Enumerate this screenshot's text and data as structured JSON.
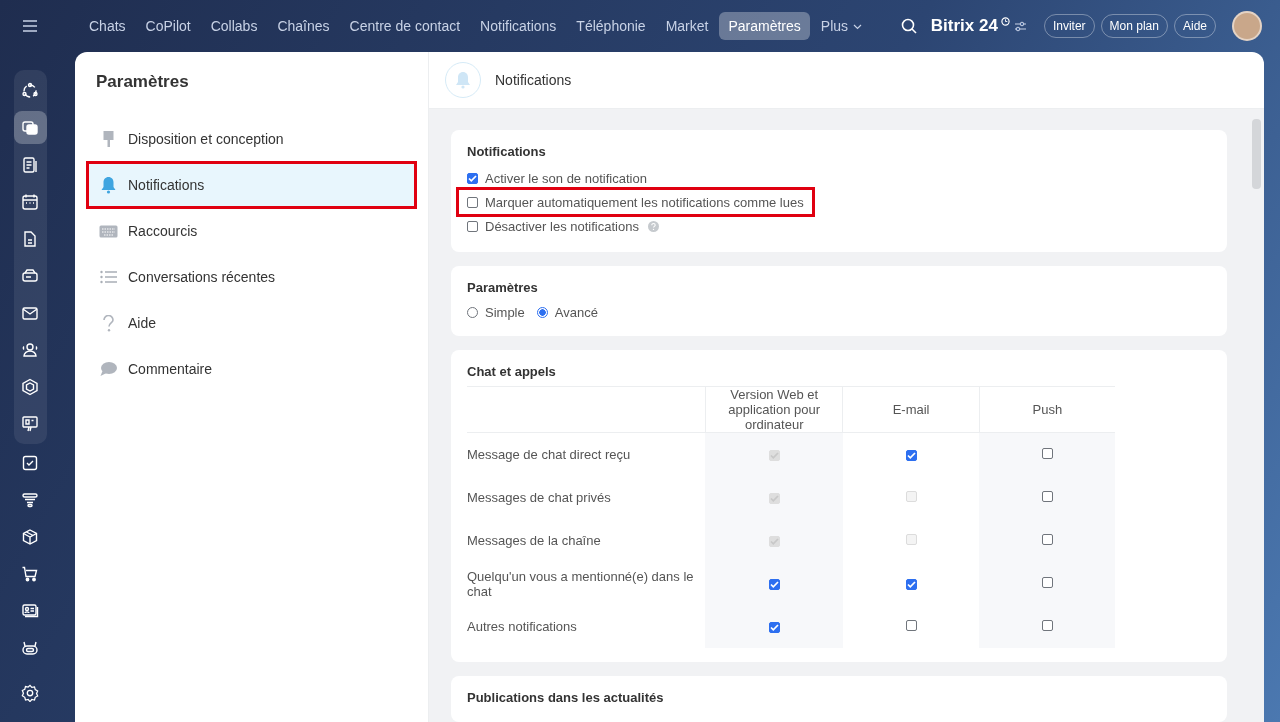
{
  "top_nav": {
    "items": [
      {
        "label": "Chats",
        "selected": false
      },
      {
        "label": "CoPilot",
        "selected": false
      },
      {
        "label": "Collabs",
        "selected": false
      },
      {
        "label": "Chaînes",
        "selected": false
      },
      {
        "label": "Centre de contact",
        "selected": false
      },
      {
        "label": "Notifications",
        "selected": false
      },
      {
        "label": "Téléphonie",
        "selected": false
      },
      {
        "label": "Market",
        "selected": false
      },
      {
        "label": "Paramètres",
        "selected": true
      },
      {
        "label": "Plus",
        "selected": false
      }
    ],
    "brand": "Bitrix 24",
    "buttons": [
      "Inviter",
      "Mon plan",
      "Aide"
    ]
  },
  "rail": [
    {
      "selected": false
    },
    {
      "selected": true
    },
    {
      "selected": false
    },
    {
      "selected": false
    },
    {
      "selected": false
    },
    {
      "selected": false
    },
    {
      "selected": false
    },
    {
      "selected": false
    },
    {
      "selected": false
    },
    {
      "selected": false
    },
    {
      "selected": false
    },
    {
      "selected": false
    },
    {
      "selected": false
    },
    {
      "selected": false
    },
    {
      "selected": false
    },
    {
      "selected": false
    }
  ],
  "sidebar": {
    "title": "Paramètres",
    "items": [
      {
        "label": "Disposition et conception",
        "kind": "brush",
        "selected": false,
        "highlighted": false
      },
      {
        "label": "Notifications",
        "kind": "bell",
        "selected": true,
        "highlighted": true
      },
      {
        "label": "Raccourcis",
        "kind": "keyboard",
        "selected": false,
        "highlighted": false
      },
      {
        "label": "Conversations récentes",
        "kind": "list",
        "selected": false,
        "highlighted": false
      },
      {
        "label": "Aide",
        "kind": "help",
        "selected": false,
        "highlighted": false
      },
      {
        "label": "Commentaire",
        "kind": "comment",
        "selected": false,
        "highlighted": false
      }
    ]
  },
  "content": {
    "title": "Notifications",
    "notifications": {
      "title": "Notifications",
      "options": [
        {
          "label": "Activer le son de notification",
          "checked": true,
          "highlighted": false,
          "help": false
        },
        {
          "label": "Marquer automatiquement les notifications comme lues",
          "checked": false,
          "highlighted": true,
          "help": false
        },
        {
          "label": "Désactiver les notifications",
          "checked": false,
          "highlighted": false,
          "help": true
        }
      ]
    },
    "settings": {
      "title": "Paramètres",
      "options": [
        {
          "label": "Simple",
          "selected": false
        },
        {
          "label": "Avancé",
          "selected": true
        }
      ]
    },
    "chat": {
      "title": "Chat et appels",
      "columns": [
        "Version Web et application pour ordinateur",
        "E-mail",
        "Push"
      ],
      "rows": [
        {
          "label": "Message de chat direct reçu",
          "cells": [
            {
              "checked": true,
              "disabled": true
            },
            {
              "checked": true,
              "disabled": false
            },
            {
              "checked": false,
              "disabled": false
            }
          ]
        },
        {
          "label": "Messages de chat privés",
          "cells": [
            {
              "checked": true,
              "disabled": true
            },
            {
              "checked": false,
              "disabled": true
            },
            {
              "checked": false,
              "disabled": false
            }
          ]
        },
        {
          "label": "Messages de la chaîne",
          "cells": [
            {
              "checked": true,
              "disabled": true
            },
            {
              "checked": false,
              "disabled": true
            },
            {
              "checked": false,
              "disabled": false
            }
          ]
        },
        {
          "label": "Quelqu'un vous a mentionné(e) dans le chat",
          "cells": [
            {
              "checked": true,
              "disabled": false
            },
            {
              "checked": true,
              "disabled": false
            },
            {
              "checked": false,
              "disabled": false
            }
          ]
        },
        {
          "label": "Autres notifications",
          "cells": [
            {
              "checked": true,
              "disabled": false
            },
            {
              "checked": false,
              "disabled": false
            },
            {
              "checked": false,
              "disabled": false
            }
          ]
        }
      ]
    },
    "news": {
      "title": "Publications dans les actualités"
    }
  }
}
